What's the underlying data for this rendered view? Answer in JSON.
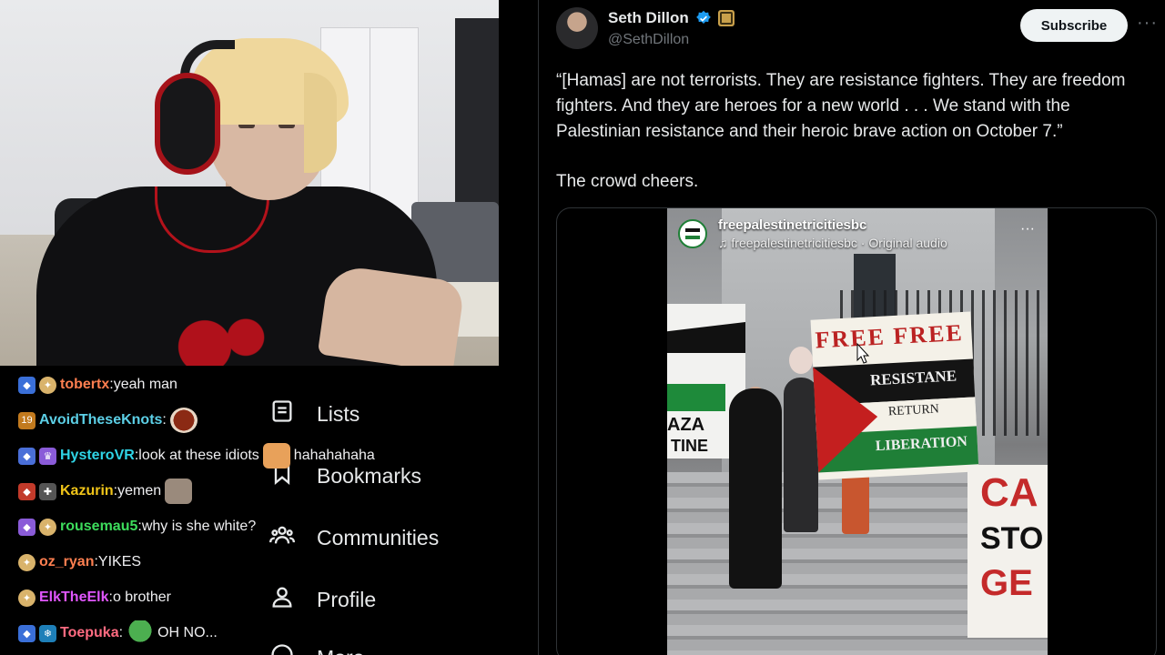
{
  "tweet": {
    "display_name": "Seth Dillon",
    "handle": "@SethDillon",
    "subscribe_label": "Subscribe",
    "more_label": "···",
    "body": "“[Hamas] are not terrorists. They are resistance fighters. They are freedom fighters. And they are heroes for a new world . . . We stand with the Palestinian resistance and their heroic brave action on October 7.”",
    "body2": "The crowd cheers.",
    "verified_color": "#1d9bf0"
  },
  "video": {
    "username": "freepalestinetricitiesbc",
    "audio": "♫ freepalestinetricitiesbc · Original audio",
    "menu": "···",
    "banner_left_1": "AZA",
    "banner_left_2": "TINE",
    "flag_banner_top": "FREE FREE",
    "flag_banner_1": "RESISTANE",
    "flag_banner_2": "RETURN",
    "flag_banner_3": "LIBERATION",
    "banner_right_1": "CA",
    "banner_right_2": "STO",
    "banner_right_3": "GE"
  },
  "sidebar_nav": [
    {
      "label": "Lists",
      "icon": "list-icon"
    },
    {
      "label": "Bookmarks",
      "icon": "bookmark-icon"
    },
    {
      "label": "Communities",
      "icon": "communities-icon"
    },
    {
      "label": "Profile",
      "icon": "profile-icon"
    },
    {
      "label": "More",
      "icon": "more-icon"
    }
  ],
  "chat": [
    {
      "user": "tobertx",
      "sep": ": ",
      "msg": "yeah man",
      "color": "#ff7f50"
    },
    {
      "user": "AvoidTheseKnots",
      "sep": ":",
      "msg": "",
      "color": "#5ccfe6",
      "emote": true
    },
    {
      "user": "HysteroVR",
      "sep": ": ",
      "msg": "look at these idiots",
      "tail": "hahahahaha",
      "color": "#2fd4e6"
    },
    {
      "user": "Kazurin",
      "sep": ": ",
      "msg": "yemen",
      "color": "#f0c419",
      "emote": true
    },
    {
      "user": "rousemau5",
      "sep": ": ",
      "msg": "why is she white?",
      "color": "#3ddc5c"
    },
    {
      "user": "oz_ryan",
      "sep": ": ",
      "msg": "YIKES",
      "color": "#ff7f50"
    },
    {
      "user": "ElkTheElk",
      "sep": ": ",
      "msg": "o brother",
      "color": "#e056fd"
    },
    {
      "user": "Toepuka",
      "sep": ": ",
      "msg": "OH NO...",
      "color": "#ff6b81",
      "emote": true
    }
  ],
  "colors": {
    "background": "#000000",
    "text": "#e7e9ea",
    "muted": "#71767b",
    "border": "#2f3336",
    "palestine_red": "#c41f1f",
    "palestine_green": "#1f7f37"
  }
}
